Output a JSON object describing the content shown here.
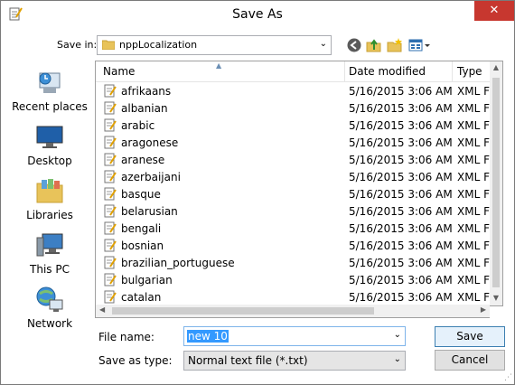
{
  "window": {
    "title": "Save As",
    "close_glyph": "✕"
  },
  "lookin": {
    "label": "Save in:",
    "value": "nppLocalization",
    "arrow": "⌄"
  },
  "places": [
    {
      "label": "Recent places",
      "icon": "recent-places-icon"
    },
    {
      "label": "Desktop",
      "icon": "desktop-icon"
    },
    {
      "label": "Libraries",
      "icon": "libraries-icon"
    },
    {
      "label": "This PC",
      "icon": "this-pc-icon"
    },
    {
      "label": "Network",
      "icon": "network-icon"
    }
  ],
  "columns": {
    "name": "Name",
    "date": "Date modified",
    "type": "Type"
  },
  "files": [
    {
      "name": "afrikaans",
      "date": "5/16/2015 3:06 AM",
      "type": "XML File"
    },
    {
      "name": "albanian",
      "date": "5/16/2015 3:06 AM",
      "type": "XML File"
    },
    {
      "name": "arabic",
      "date": "5/16/2015 3:06 AM",
      "type": "XML File"
    },
    {
      "name": "aragonese",
      "date": "5/16/2015 3:06 AM",
      "type": "XML File"
    },
    {
      "name": "aranese",
      "date": "5/16/2015 3:06 AM",
      "type": "XML File"
    },
    {
      "name": "azerbaijani",
      "date": "5/16/2015 3:06 AM",
      "type": "XML File"
    },
    {
      "name": "basque",
      "date": "5/16/2015 3:06 AM",
      "type": "XML File"
    },
    {
      "name": "belarusian",
      "date": "5/16/2015 3:06 AM",
      "type": "XML File"
    },
    {
      "name": "bengali",
      "date": "5/16/2015 3:06 AM",
      "type": "XML File"
    },
    {
      "name": "bosnian",
      "date": "5/16/2015 3:06 AM",
      "type": "XML File"
    },
    {
      "name": "brazilian_portuguese",
      "date": "5/16/2015 3:06 AM",
      "type": "XML File"
    },
    {
      "name": "bulgarian",
      "date": "5/16/2015 3:06 AM",
      "type": "XML File"
    },
    {
      "name": "catalan",
      "date": "5/16/2015 3:06 AM",
      "type": "XML File"
    }
  ],
  "form": {
    "filename_label": "File name:",
    "filename_value": "new 10",
    "type_label": "Save as type:",
    "type_value": "Normal text file (*.txt)",
    "save_label": "Save",
    "cancel_label": "Cancel"
  }
}
